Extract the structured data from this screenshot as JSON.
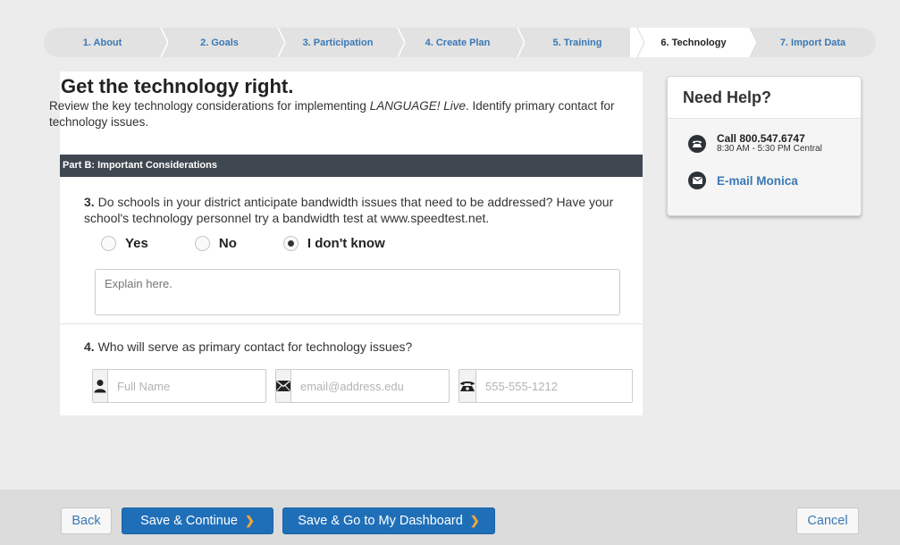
{
  "stepper": {
    "steps": [
      "1. About",
      "2. Goals",
      "3. Participation",
      "4. Create Plan",
      "5. Training",
      "6. Technology",
      "7. Import Data"
    ],
    "active_index": 5
  },
  "page": {
    "title": "Get the technology right.",
    "subtitle_pre": "Review the key technology considerations for implementing ",
    "subtitle_em": "LANGUAGE! Live",
    "subtitle_post": ". Identify primary contact for technology issues."
  },
  "part": {
    "label": "Part B: Important Considerations"
  },
  "question3": {
    "number": "3.",
    "text": "Do schools in your district anticipate bandwidth issues that need to be addressed? Have your school's technology personnel try a bandwidth test at www.speedtest.net.",
    "options": [
      "Yes",
      "No",
      "I don't know"
    ],
    "selected": "I don't know",
    "explain_placeholder": "Explain here."
  },
  "question4": {
    "number": "4.",
    "text": "Who will serve as primary contact for technology issues?",
    "name_placeholder": "Full Name",
    "email_placeholder": "email@address.edu",
    "phone_placeholder": "555-555-1212"
  },
  "help": {
    "title": "Need Help?",
    "call_label": "Call 800.547.6747",
    "call_hours": "8:30 AM - 5:30 PM Central",
    "email_label": "E-mail Monica"
  },
  "footer": {
    "back": "Back",
    "save_continue": "Save & Continue",
    "save_dashboard": "Save & Go to My Dashboard",
    "cancel": "Cancel",
    "chevron": "❯"
  },
  "colors": {
    "link_blue": "#3a78b5",
    "button_blue": "#1f6fb8",
    "part_bar": "#3f4750",
    "chevron_orange": "#f2a63a"
  }
}
